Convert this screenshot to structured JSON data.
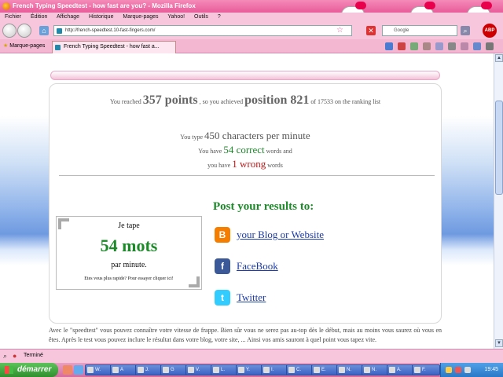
{
  "window": {
    "title": "French Typing Speedtest - how fast are you? - Mozilla Firefox"
  },
  "menu": [
    "Fichier",
    "Édition",
    "Affichage",
    "Historique",
    "Marque-pages",
    "Yahoo!",
    "Outils",
    "?"
  ],
  "nav": {
    "url": "http://french-speedtest.10-fast-fingers.com/",
    "search_placeholder": "Google"
  },
  "bookmarks_label": "Marque-pages",
  "tab_title": "French Typing Speedtest - how fast a...",
  "result": {
    "reached_prefix": "You reached",
    "points": "357 points",
    "achieved_text": ", so you achieved",
    "position": "position 821",
    "ranking_text": "of 17533 on the ranking list",
    "type_prefix": "You type",
    "cpm": "450 characters per minute",
    "have_prefix": "You have",
    "correct": "54 correct",
    "words_suffix": "words and",
    "have_prefix2": "you have",
    "wrong": "1 wrong",
    "words_suffix2": "words"
  },
  "badge": {
    "line1": "Je tape",
    "line2": "54 mots",
    "line3": "par minute.",
    "line4": "Etes vous plus rapide? Pour essayer cliquer ici!"
  },
  "share": {
    "title": "Post your results to:",
    "items": [
      {
        "label": "your Blog or Website",
        "icon": "blogger-icon",
        "color": "#f57d00"
      },
      {
        "label": "FaceBook",
        "icon": "facebook-icon",
        "color": "#3b5998"
      },
      {
        "label": "Twitter",
        "icon": "twitter-icon",
        "color": "#33ccff"
      }
    ]
  },
  "paragraph": "Avec le \"speedtest\" vous pouvez connaître votre vitesse de frappe. Bien sûr vous ne serez pas au-top dès le début, mais au moins vous saurez où vous en êtes. Après le test vous pouvez inclure le résultat dans votre blog, votre site, ... Ainsi vos amis sauront à quel point vous tapez vite.",
  "status": "Terminé",
  "taskbar": {
    "start": "démarrer",
    "items": [
      "W.",
      "A",
      "J.",
      "G",
      "V.",
      "L.",
      "Y.",
      "I.",
      "C.",
      "E.",
      "N.",
      "N.",
      "A.",
      "F."
    ],
    "clock": "19:45"
  },
  "colors": {
    "accent_pink": "#f48ab8",
    "green": "#1d8a2a",
    "red": "#c01818",
    "link_blue": "#1a3aa8"
  }
}
